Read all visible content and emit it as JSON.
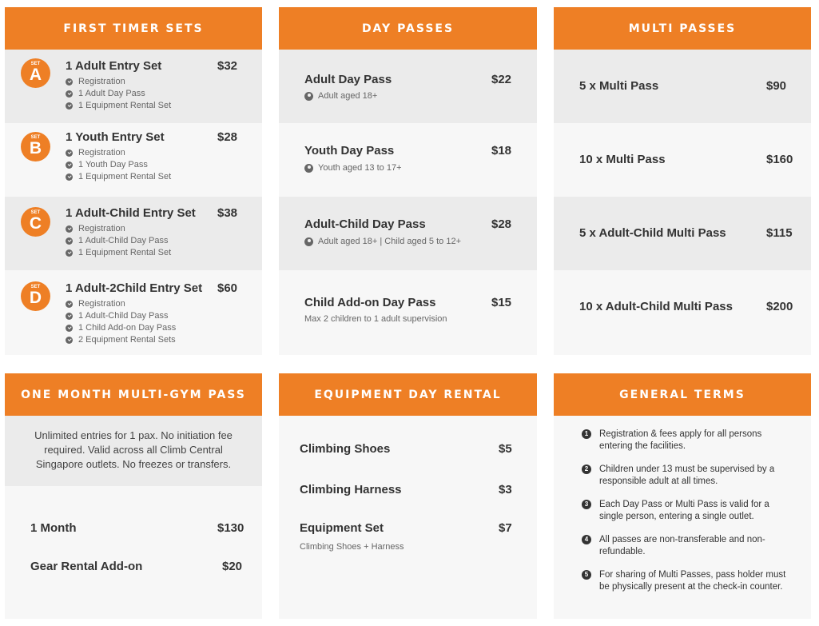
{
  "colors": {
    "accent": "#ee7f25",
    "row_grey": "#ebebeb",
    "row_light": "#f7f7f7"
  },
  "first_timer": {
    "header": "FIRST TIMER SETS",
    "sets": [
      {
        "badge_top": "SET",
        "badge_letter": "A",
        "title": "1 Adult Entry Set",
        "price": "$32",
        "items": [
          "Registration",
          "1 Adult Day Pass",
          "1 Equipment Rental Set"
        ]
      },
      {
        "badge_top": "SET",
        "badge_letter": "B",
        "title": "1 Youth Entry Set",
        "price": "$28",
        "items": [
          "Registration",
          "1 Youth Day Pass",
          "1 Equipment Rental Set"
        ]
      },
      {
        "badge_top": "SET",
        "badge_letter": "C",
        "title": "1 Adult-Child Entry Set",
        "price": "$38",
        "items": [
          "Registration",
          "1 Adult-Child Day Pass",
          "1 Equipment Rental Set"
        ]
      },
      {
        "badge_top": "SET",
        "badge_letter": "D",
        "title": "1 Adult-2Child Entry Set",
        "price": "$60",
        "items": [
          "Registration",
          "1 Adult-Child Day Pass",
          "1 Child Add-on Day Pass",
          "2 Equipment Rental Sets"
        ]
      }
    ]
  },
  "day_passes": {
    "header": "DAY PASSES",
    "items": [
      {
        "title": "Adult Day Pass",
        "price": "$22",
        "sub": "Adult aged 18+"
      },
      {
        "title": "Youth Day Pass",
        "price": "$18",
        "sub": "Youth aged 13 to 17+"
      },
      {
        "title": "Adult-Child Day Pass",
        "price": "$28",
        "sub": "Adult aged 18+ | Child aged 5 to 12+"
      },
      {
        "title": "Child Add-on Day Pass",
        "price": "$15",
        "sub": "Max 2 children to 1 adult supervision"
      }
    ]
  },
  "multi_passes": {
    "header": "MULTI PASSES",
    "items": [
      {
        "title": "5 x Multi Pass",
        "price": "$90"
      },
      {
        "title": "10 x Multi Pass",
        "price": "$160"
      },
      {
        "title": "5 x Adult-Child Multi Pass",
        "price": "$115"
      },
      {
        "title": "10 x Adult-Child Multi Pass",
        "price": "$200"
      }
    ]
  },
  "month_pass": {
    "header": "ONE MONTH MULTI-GYM PASS",
    "description": "Unlimited entries for 1 pax. No initiation fee required. Valid across all Climb Central Singapore outlets. No freezes or transfers.",
    "items": [
      {
        "title": "1 Month",
        "price": "$130"
      },
      {
        "title": "Gear Rental Add-on",
        "price": "$20"
      }
    ]
  },
  "equipment": {
    "header": "EQUIPMENT DAY RENTAL",
    "items": [
      {
        "title": "Climbing Shoes",
        "price": "$5"
      },
      {
        "title": "Climbing Harness",
        "price": "$3"
      },
      {
        "title": "Equipment Set",
        "price": "$7",
        "sub": "Climbing Shoes + Harness"
      }
    ]
  },
  "terms": {
    "header": "GENERAL TERMS",
    "items": [
      {
        "num": "1",
        "text": "Registration & fees apply for all persons entering the facilities."
      },
      {
        "num": "2",
        "text": "Children under 13 must be supervised by a responsible adult at all times."
      },
      {
        "num": "3",
        "text": "Each Day Pass or Multi Pass is valid for a single person, entering a single outlet."
      },
      {
        "num": "4",
        "text": "All passes are non-transferable and non-refundable."
      },
      {
        "num": "5",
        "text": "For sharing of Multi Passes, pass holder must be physically present at the check-in counter."
      }
    ]
  }
}
